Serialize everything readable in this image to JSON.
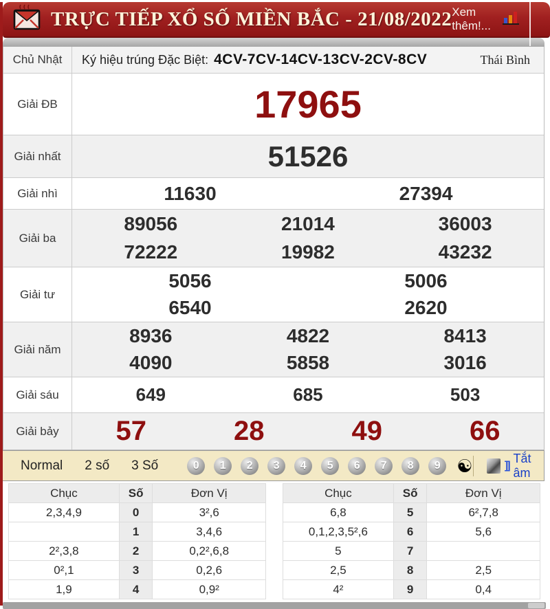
{
  "header": {
    "title": "TRỰC TIẾP XỔ SỐ MIỀN BẮC - 21/08/2022",
    "more_link": "Xem thêm!..."
  },
  "results": {
    "day": "Chủ Nhật",
    "sign_label": "Ký hiệu trúng Đặc Biệt:",
    "sign_value": "4CV-7CV-14CV-13CV-2CV-8CV",
    "province": "Thái Bình",
    "prizes": [
      {
        "label": "Giải ĐB",
        "values": [
          "17965"
        ]
      },
      {
        "label": "Giải nhất",
        "values": [
          "51526"
        ]
      },
      {
        "label": "Giải nhì",
        "values": [
          "11630",
          "27394"
        ]
      },
      {
        "label": "Giải ba",
        "values": [
          "89056",
          "21014",
          "36003",
          "72222",
          "19982",
          "43232"
        ]
      },
      {
        "label": "Giải tư",
        "values": [
          "5056",
          "5006",
          "6540",
          "2620"
        ]
      },
      {
        "label": "Giải năm",
        "values": [
          "8936",
          "4822",
          "8413",
          "4090",
          "5858",
          "3016"
        ]
      },
      {
        "label": "Giải sáu",
        "values": [
          "649",
          "685",
          "503"
        ]
      },
      {
        "label": "Giải bảy",
        "values": [
          "57",
          "28",
          "49",
          "66"
        ]
      }
    ]
  },
  "toolbar": {
    "tabs": [
      "Normal",
      "2 số",
      "3 Số"
    ],
    "balls": [
      "0",
      "1",
      "2",
      "3",
      "4",
      "5",
      "6",
      "7",
      "8",
      "9"
    ],
    "yinyang_icon": "☯",
    "mute_label": "Tắt âm",
    "sound_wave": "]]"
  },
  "stats": {
    "headers": {
      "tens": "Chục",
      "digit": "Số",
      "units": "Đơn Vị"
    },
    "left": [
      {
        "tens": "2,3,4,9",
        "digit": "0",
        "units": "3²,6"
      },
      {
        "tens": "",
        "digit": "1",
        "units": "3,4,6"
      },
      {
        "tens": "2²,3,8",
        "digit": "2",
        "units": "0,2²,6,8"
      },
      {
        "tens": "0²,1",
        "digit": "3",
        "units": "0,2,6"
      },
      {
        "tens": "1,9",
        "digit": "4",
        "units": "0,9²"
      }
    ],
    "right": [
      {
        "tens": "6,8",
        "digit": "5",
        "units": "6²,7,8"
      },
      {
        "tens": "0,1,2,3,5²,6",
        "digit": "6",
        "units": "5,6"
      },
      {
        "tens": "5",
        "digit": "7",
        "units": ""
      },
      {
        "tens": "2,5",
        "digit": "8",
        "units": "2,5"
      },
      {
        "tens": "4²",
        "digit": "9",
        "units": "0,4"
      }
    ]
  },
  "colors": {
    "accent_red": "#9e1b1b",
    "number_red": "#8e0f0f",
    "toolbar_bg": "#f3e9c5",
    "link_blue": "#1a41c8"
  }
}
